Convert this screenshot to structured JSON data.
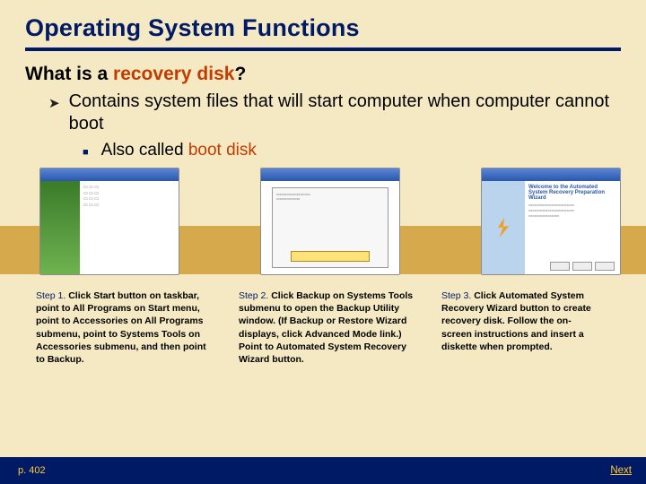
{
  "title": "Operating System Functions",
  "question_pre": "What is a ",
  "question_hl": "recovery disk",
  "question_post": "?",
  "bullet1": "Contains system files that will start computer when computer cannot boot",
  "bullet2_pre": "Also called ",
  "bullet2_hl": "boot disk",
  "thumbs": {
    "t3_title": "Welcome to the Automated System Recovery Preparation Wizard"
  },
  "steps": [
    {
      "lead": "Step 1.",
      "body": " Click Start button on taskbar, point to All Programs on Start menu, point to Accessories on All Programs submenu, point to Systems Tools on Accessories submenu, and then point to Backup."
    },
    {
      "lead": "Step 2.",
      "body": " Click Backup on Systems Tools submenu to open the Backup Utility window. (If Backup or Restore Wizard displays, click Advanced Mode link.) Point to Automated System Recovery Wizard button."
    },
    {
      "lead": "Step 3.",
      "body": " Click Automated System Recovery Wizard button to create recovery disk. Follow the on-screen instructions and insert a diskette when prompted."
    }
  ],
  "page_ref": "p. 402",
  "next_label": "Next"
}
